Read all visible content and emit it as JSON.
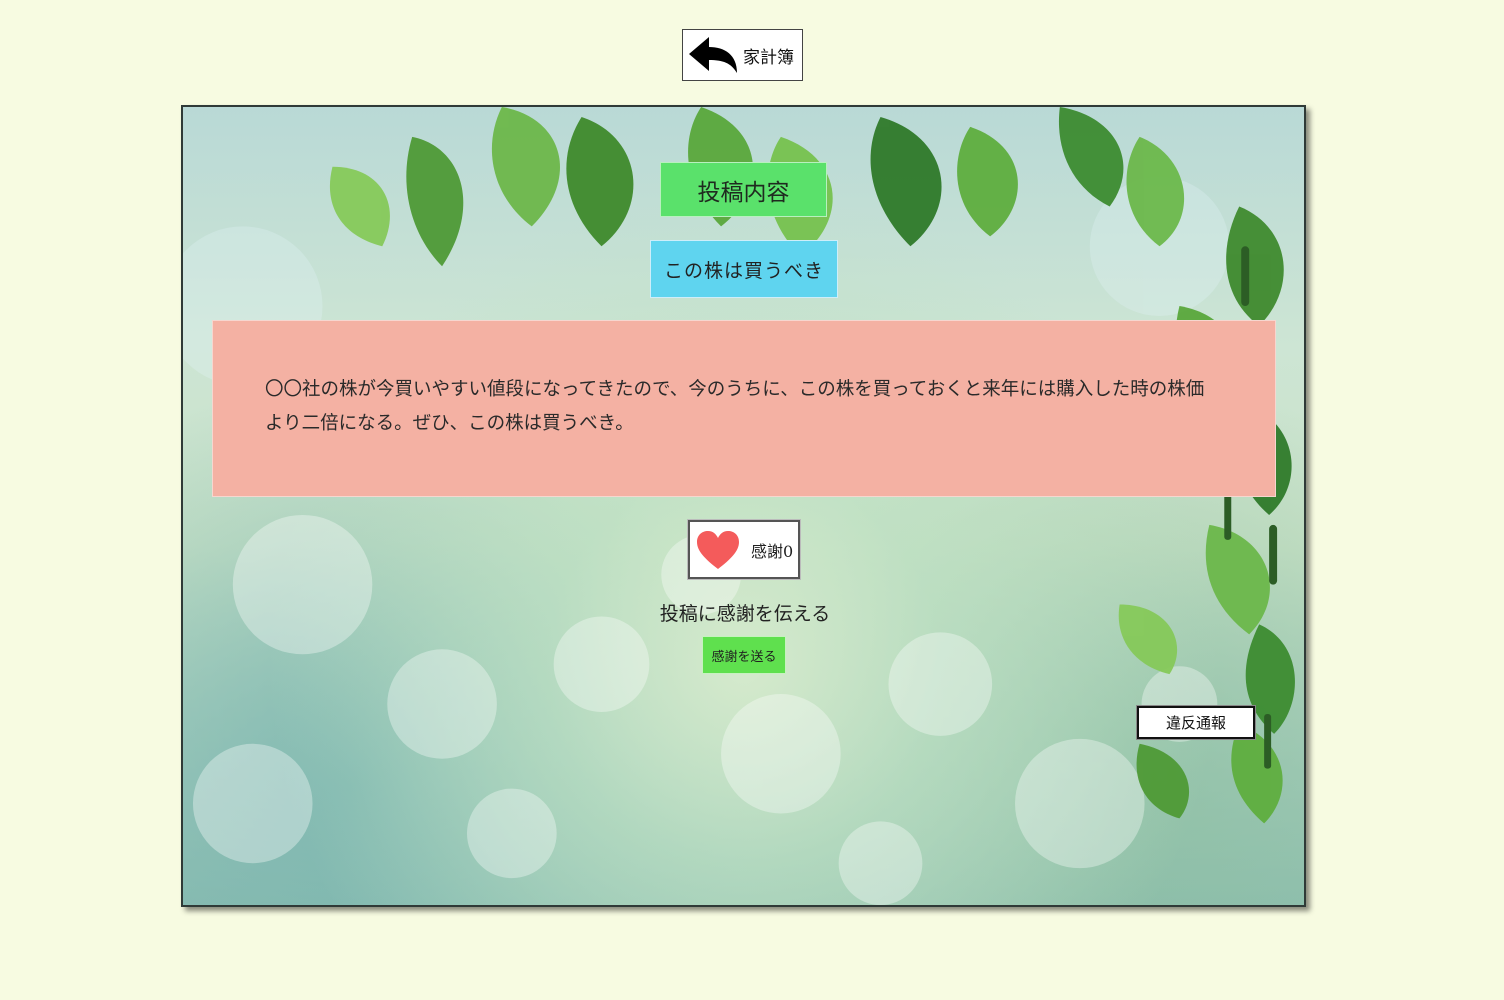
{
  "nav": {
    "back_label": "家計簿",
    "back_icon": "back-arrow-icon"
  },
  "post": {
    "section_title": "投稿内容",
    "subject": "この株は買うべき",
    "body": "〇〇社の株が今買いやすい値段になってきたので、今のうちに、この株を買っておくと来年には購入した時の株価より二倍になる。ぜひ、この株は買うべき。"
  },
  "thanks": {
    "icon": "heart-icon",
    "count_label": "感謝0",
    "caption": "投稿に感謝を伝える",
    "send_label": "感謝を送る"
  },
  "report": {
    "label": "違反通報"
  },
  "colors": {
    "page_background": "#f7fbe1",
    "title_box": "#5ae16b",
    "subject_box": "#5fd4ef",
    "content_box": "#f4b1a3",
    "send_button": "#5fe04e",
    "heart": "#f45b5b"
  }
}
